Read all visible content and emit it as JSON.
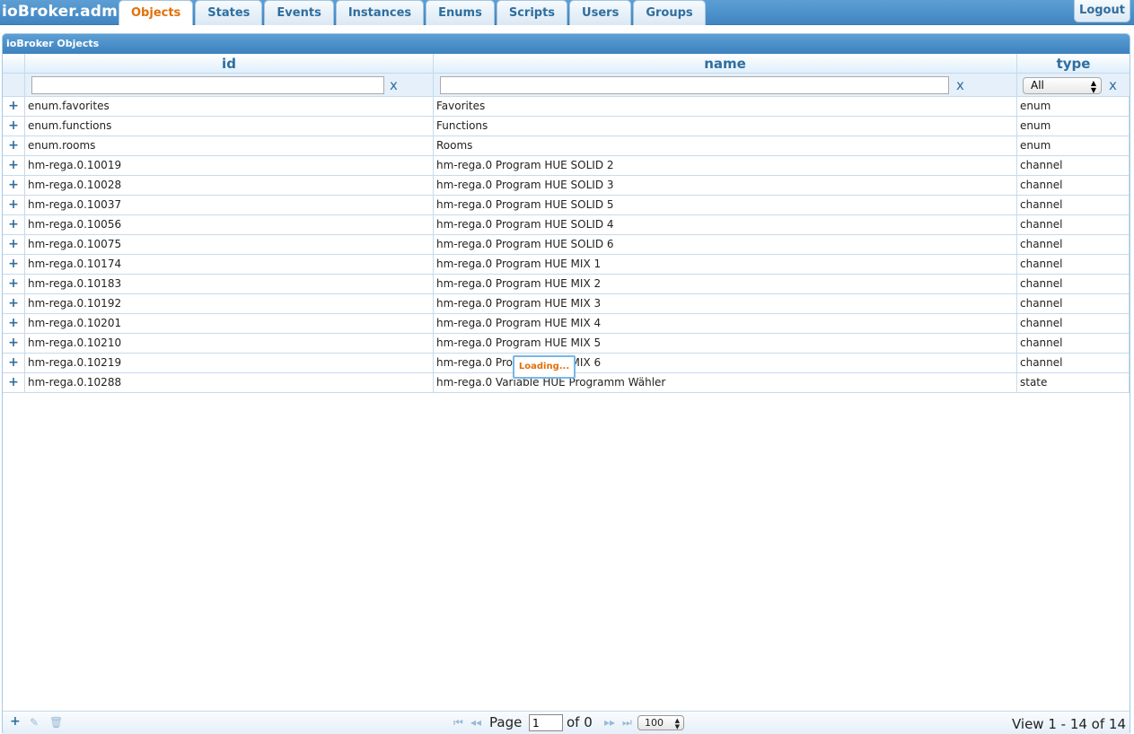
{
  "app_title": "ioBroker.admin",
  "tabs": [
    {
      "label": "Objects",
      "active": true
    },
    {
      "label": "States",
      "active": false
    },
    {
      "label": "Events",
      "active": false
    },
    {
      "label": "Instances",
      "active": false
    },
    {
      "label": "Enums",
      "active": false
    },
    {
      "label": "Scripts",
      "active": false
    },
    {
      "label": "Users",
      "active": false
    },
    {
      "label": "Groups",
      "active": false
    }
  ],
  "logout_label": "Logout",
  "grid": {
    "caption": "ioBroker Objects",
    "columns": {
      "id": "id",
      "name": "name",
      "type": "type"
    },
    "filters": {
      "id_value": "",
      "name_value": "",
      "clear_label": "x",
      "type_selected": "All"
    },
    "expand_symbol": "+",
    "rows": [
      {
        "id": "enum.favorites",
        "name": "Favorites",
        "type": "enum"
      },
      {
        "id": "enum.functions",
        "name": "Functions",
        "type": "enum"
      },
      {
        "id": "enum.rooms",
        "name": "Rooms",
        "type": "enum"
      },
      {
        "id": "hm-rega.0.10019",
        "name": "hm-rega.0 Program HUE SOLID 2",
        "type": "channel"
      },
      {
        "id": "hm-rega.0.10028",
        "name": "hm-rega.0 Program HUE SOLID 3",
        "type": "channel"
      },
      {
        "id": "hm-rega.0.10037",
        "name": "hm-rega.0 Program HUE SOLID 5",
        "type": "channel"
      },
      {
        "id": "hm-rega.0.10056",
        "name": "hm-rega.0 Program HUE SOLID 4",
        "type": "channel"
      },
      {
        "id": "hm-rega.0.10075",
        "name": "hm-rega.0 Program HUE SOLID 6",
        "type": "channel"
      },
      {
        "id": "hm-rega.0.10174",
        "name": "hm-rega.0 Program HUE MIX 1",
        "type": "channel"
      },
      {
        "id": "hm-rega.0.10183",
        "name": "hm-rega.0 Program HUE MIX 2",
        "type": "channel"
      },
      {
        "id": "hm-rega.0.10192",
        "name": "hm-rega.0 Program HUE MIX 3",
        "type": "channel"
      },
      {
        "id": "hm-rega.0.10201",
        "name": "hm-rega.0 Program HUE MIX 4",
        "type": "channel"
      },
      {
        "id": "hm-rega.0.10210",
        "name": "hm-rega.0 Program HUE MIX 5",
        "type": "channel"
      },
      {
        "id": "hm-rega.0.10219",
        "name": "hm-rega.0 Program HUE MIX 6",
        "type": "channel"
      },
      {
        "id": "hm-rega.0.10288",
        "name": "hm-rega.0 Variable HUE Programm Wähler",
        "type": "state"
      }
    ],
    "loading_label": "Loading..."
  },
  "pager": {
    "page_label": "Page",
    "page_value": "1",
    "of_label": "of 0",
    "rows_per_page": "100",
    "view_info": "View 1 - 14 of 14"
  },
  "icons": {
    "add": "plus-icon",
    "edit": "pencil-icon",
    "delete": "trash-icon",
    "first": "first-page-icon",
    "prev": "prev-page-icon",
    "next": "next-page-icon",
    "last": "last-page-icon"
  },
  "colors": {
    "accent": "#e17009",
    "header_blue": "#4a90c9",
    "link_blue": "#2e6e9e",
    "border": "#c5dbec"
  }
}
